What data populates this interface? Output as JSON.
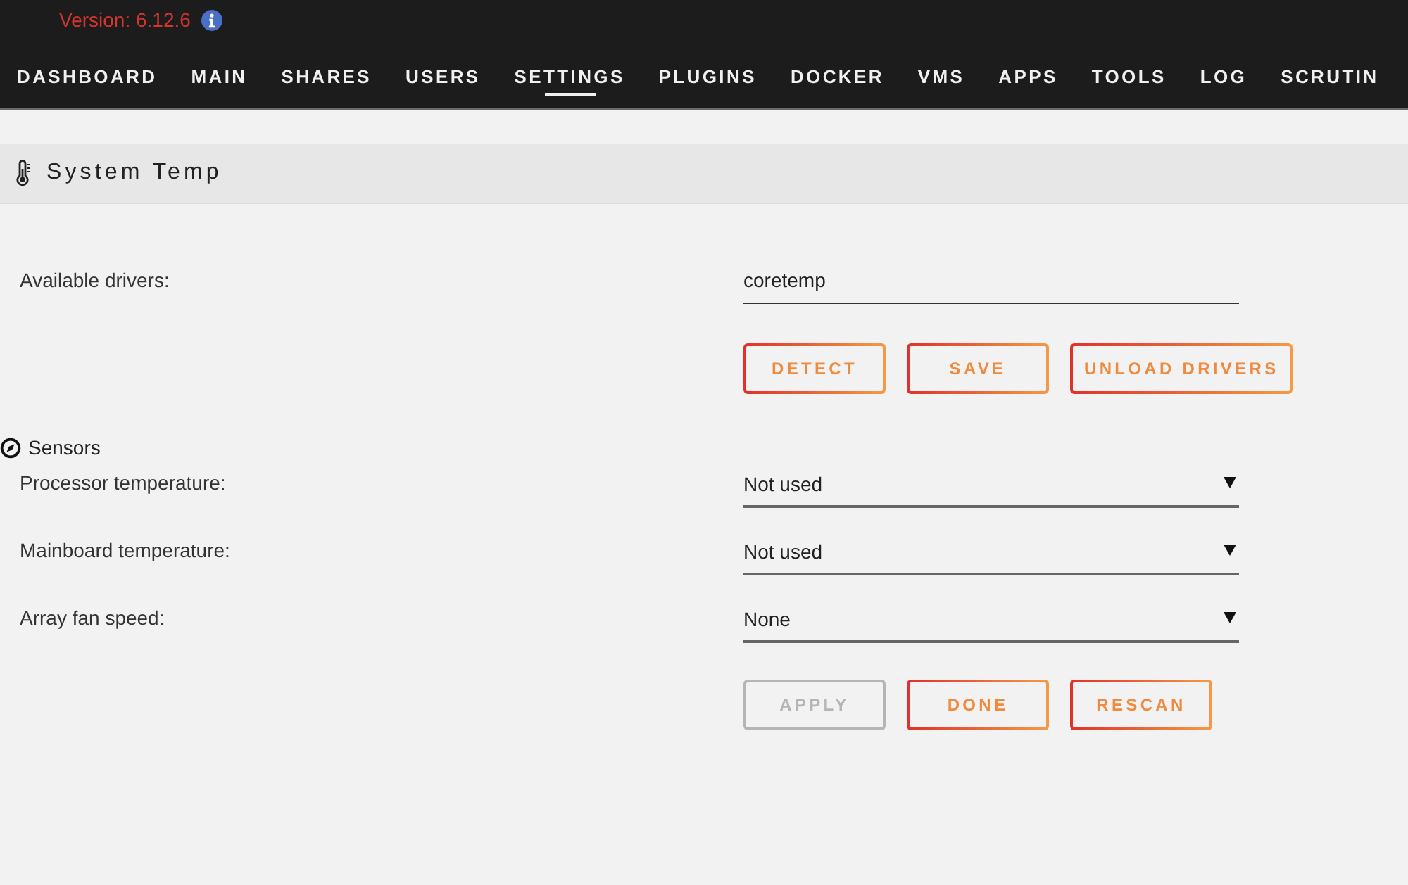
{
  "header": {
    "version": "Version: 6.12.6"
  },
  "nav": [
    {
      "label": "DASHBOARD",
      "selected": false
    },
    {
      "label": "MAIN",
      "selected": false
    },
    {
      "label": "SHARES",
      "selected": false
    },
    {
      "label": "USERS",
      "selected": false
    },
    {
      "label": "SETTINGS",
      "selected": true
    },
    {
      "label": "PLUGINS",
      "selected": false
    },
    {
      "label": "DOCKER",
      "selected": false
    },
    {
      "label": "VMS",
      "selected": false
    },
    {
      "label": "APPS",
      "selected": false
    },
    {
      "label": "TOOLS",
      "selected": false
    },
    {
      "label": "LOG",
      "selected": false
    },
    {
      "label": "SCRUTIN",
      "selected": false
    }
  ],
  "section": {
    "title": "System Temp"
  },
  "drivers": {
    "label": "Available drivers:",
    "value": "coretemp"
  },
  "driver_buttons": [
    {
      "label": "DETECT",
      "disabled": false
    },
    {
      "label": "SAVE",
      "disabled": false
    },
    {
      "label": "UNLOAD DRIVERS",
      "disabled": false
    }
  ],
  "sensors": {
    "title": "Sensors",
    "fields": [
      {
        "label": "Processor temperature:",
        "value": "Not used"
      },
      {
        "label": "Mainboard temperature:",
        "value": "Not used"
      },
      {
        "label": "Array fan speed:",
        "value": "None"
      }
    ]
  },
  "sensor_buttons": [
    {
      "label": "APPLY",
      "disabled": true
    },
    {
      "label": "DONE",
      "disabled": false
    },
    {
      "label": "RESCAN",
      "disabled": false
    }
  ]
}
